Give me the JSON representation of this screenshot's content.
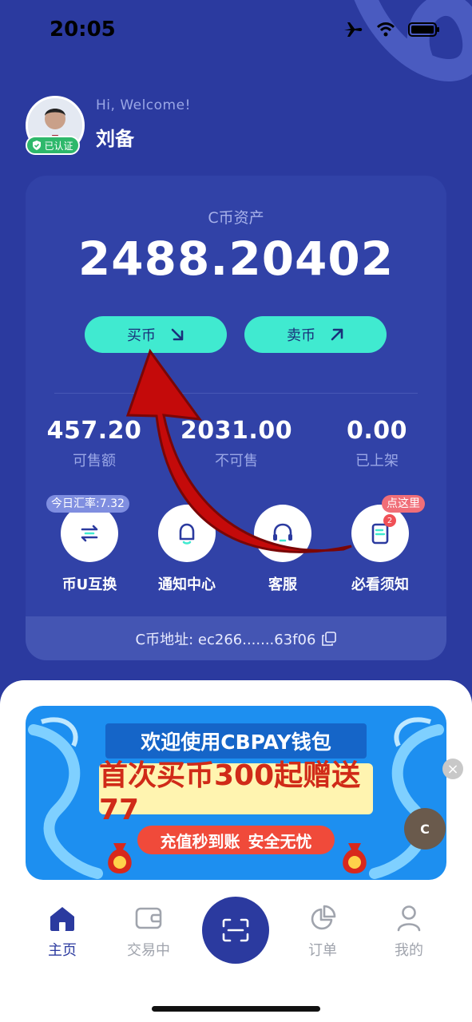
{
  "status": {
    "time": "20:05"
  },
  "user": {
    "greeting": "Hi, Welcome!",
    "name": "刘备",
    "verified_label": "已认证"
  },
  "asset": {
    "label": "C币资产",
    "value": "2488.20402",
    "buy_label": "买币",
    "sell_label": "卖币"
  },
  "stats": [
    {
      "value": "457.20",
      "label": "可售额"
    },
    {
      "value": "2031.00",
      "label": "不可售"
    },
    {
      "value": "0.00",
      "label": "已上架"
    }
  ],
  "tools": [
    {
      "label": "币U互换",
      "icon": "exchange-icon",
      "tag": "今日汇率:7.32"
    },
    {
      "label": "通知中心",
      "icon": "bell-icon"
    },
    {
      "label": "客服",
      "icon": "headset-icon"
    },
    {
      "label": "必看须知",
      "icon": "notice-doc-icon",
      "tag": "点这里",
      "badge": "2"
    }
  ],
  "address": {
    "text": "C币地址: ec266.......63f06"
  },
  "banner": {
    "line1": "欢迎使用CBPAY钱包",
    "line2": "首次买币300起赠送77",
    "line3a": "充值秒到账",
    "line3b": "安全无忧",
    "coin_letter": "C"
  },
  "tabbar": {
    "items": [
      {
        "label": "主页",
        "icon": "home-icon",
        "active": true
      },
      {
        "label": "交易中",
        "icon": "wallet-icon"
      },
      {
        "label": "订单",
        "icon": "pie-chart-icon"
      },
      {
        "label": "我的",
        "icon": "user-icon"
      }
    ],
    "center_icon": "scan-icon"
  },
  "colors": {
    "primary": "#2b3a9f",
    "card": "#3142a7",
    "accent": "#40ead0",
    "verified": "#2eb86b",
    "alert": "#f05056"
  }
}
